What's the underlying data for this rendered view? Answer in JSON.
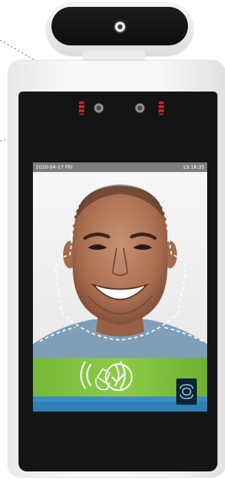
{
  "status_bar": {
    "date": "2020-04-17 FRI",
    "time": "13:18:35"
  },
  "verification": {
    "state": "success",
    "icon": "check-circle-icon"
  },
  "controls": {
    "face_scan_icon": "face-scan-icon",
    "nfc_icon": "nfc-card-icon"
  },
  "colors": {
    "success_green": "#8ccc46",
    "info_blue": "#2f7fb4",
    "status_bar_gray": "#7e7e7e",
    "ir_led_red": "#c0262b"
  }
}
